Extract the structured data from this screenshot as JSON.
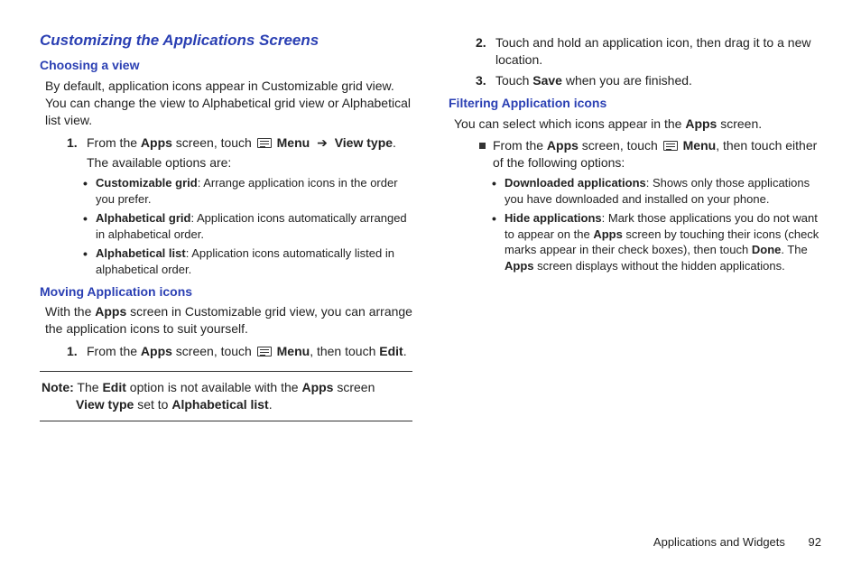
{
  "title": "Customizing the Applications Screens",
  "left": {
    "h_choosing": "Choosing a view",
    "p_choosing": "By default, application icons appear in Customizable grid view. You can change the view to Alphabetical grid view or Alphabetical list view.",
    "step1_pre": "From the ",
    "apps": "Apps",
    "step1_mid": " screen, touch ",
    "menu": "Menu",
    "arrow": "➔",
    "viewtype": "View type",
    "step1_end": ".",
    "step1_sub": "The available options are:",
    "b_cust_t": "Customizable grid",
    "b_cust_d": ": Arrange application icons in the order you prefer.",
    "b_agrid_t": "Alphabetical grid",
    "b_agrid_d": ": Application icons automatically arranged in alphabetical order.",
    "b_alist_t": "Alphabetical list",
    "b_alist_d": ": Application icons automatically listed in alphabetical order.",
    "h_moving": "Moving Application icons",
    "p_moving_a": "With the ",
    "p_moving_b": " screen in Customizable grid view, you can arrange the application icons to suit yourself.",
    "mstep1_a": "From the ",
    "mstep1_b": " screen, touch ",
    "mstep1_c": ", then touch ",
    "edit": "Edit",
    "note_lbl": "Note:",
    "note_a": "The ",
    "note_b": " option is not available with the ",
    "note_c": " screen ",
    "note_d": " set to ",
    "viewtype2": "View type",
    "alist": "Alphabetical list"
  },
  "right": {
    "step2": "Touch and hold an application icon, then drag it to a new location.",
    "step3_a": "Touch ",
    "save": "Save",
    "step3_b": " when you are finished.",
    "h_filter": "Filtering Application icons",
    "p_filter_a": "You can select which icons appear in the ",
    "p_filter_b": " screen.",
    "sq_a": "From the ",
    "sq_b": " screen, touch ",
    "sq_c": ", then touch either of the following options:",
    "b_dl_t": "Downloaded applications",
    "b_dl_d": ": Shows only those applications you have downloaded and installed on your phone.",
    "b_hide_t": "Hide applications",
    "b_hide_d1": ": Mark those applications you do not want to appear on the ",
    "b_hide_d2": " screen by touching their icons (check marks appear in their check boxes), then touch ",
    "done": "Done",
    "b_hide_d3": ". The ",
    "b_hide_d4": " screen displays without the hidden applications."
  },
  "footer": {
    "section": "Applications and Widgets",
    "page": "92"
  }
}
